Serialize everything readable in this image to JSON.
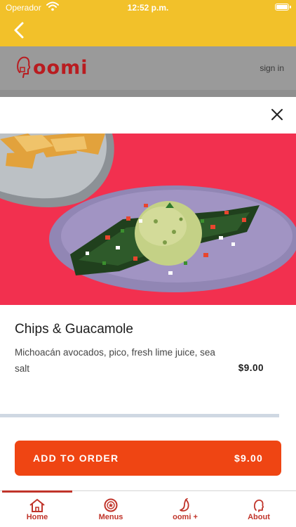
{
  "status_bar": {
    "carrier": "Operador",
    "time": "12:52 p.m."
  },
  "nav": {
    "back_icon": "chevron-left-icon"
  },
  "header": {
    "logo_text": "oomi",
    "signin_label": "sign in"
  },
  "modal": {
    "close_icon": "close-icon",
    "item": {
      "name": "Chips & Guacamole",
      "description": "Michoacán avocados, pico, fresh lime juice, sea salt",
      "price": "$9.00"
    },
    "add_button": {
      "label": "ADD TO ORDER",
      "price": "$9.00"
    }
  },
  "tabs": [
    {
      "label": "Home",
      "icon": "home-icon",
      "active": true
    },
    {
      "label": "Menus",
      "icon": "menu-badge-icon"
    },
    {
      "label": "oomi +",
      "icon": "chili-icon"
    },
    {
      "label": "About",
      "icon": "head-icon"
    }
  ],
  "colors": {
    "accent_yellow": "#f2c12a",
    "brand_red": "#b91c20",
    "button_orange": "#ef4513",
    "tab_red": "#c0342a"
  }
}
